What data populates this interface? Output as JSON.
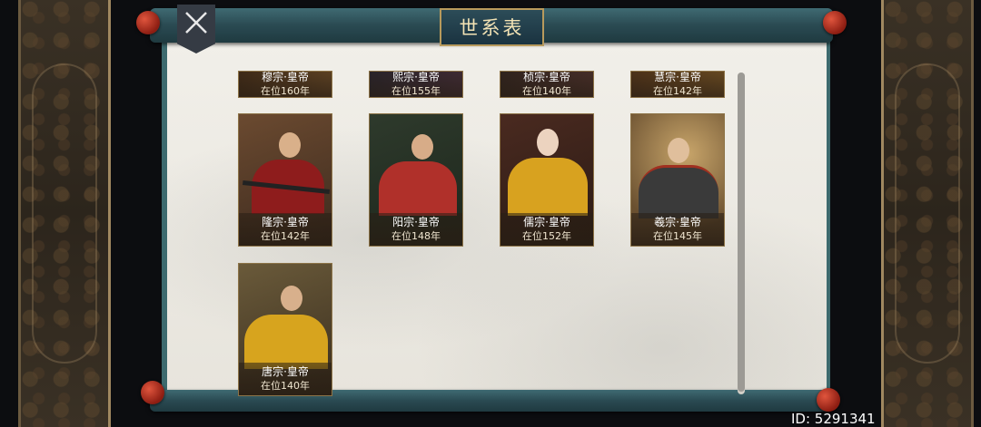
{
  "title": "世系表",
  "player_id": "ID: 5291341",
  "emperors_partial": [
    {
      "name": "穆宗·皇帝",
      "reign": "在位160年"
    },
    {
      "name": "熙宗·皇帝",
      "reign": "在位155年"
    },
    {
      "name": "桢宗·皇帝",
      "reign": "在位140年"
    },
    {
      "name": "慧宗·皇帝",
      "reign": "在位142年"
    }
  ],
  "emperors": [
    {
      "name": "隆宗·皇帝",
      "reign": "在位142年",
      "robe": "#8e1c1c"
    },
    {
      "name": "阳宗·皇帝",
      "reign": "在位148年",
      "robe": "#b0302a"
    },
    {
      "name": "儒宗·皇帝",
      "reign": "在位152年",
      "robe": "#d8a21f"
    },
    {
      "name": "羲宗·皇帝",
      "reign": "在位145年",
      "robe": "#3a3a3a"
    },
    {
      "name": "唐宗·皇帝",
      "reign": "在位140年",
      "robe": "#d7a41e"
    }
  ],
  "icons": {
    "close": "crossed-swords-icon"
  }
}
